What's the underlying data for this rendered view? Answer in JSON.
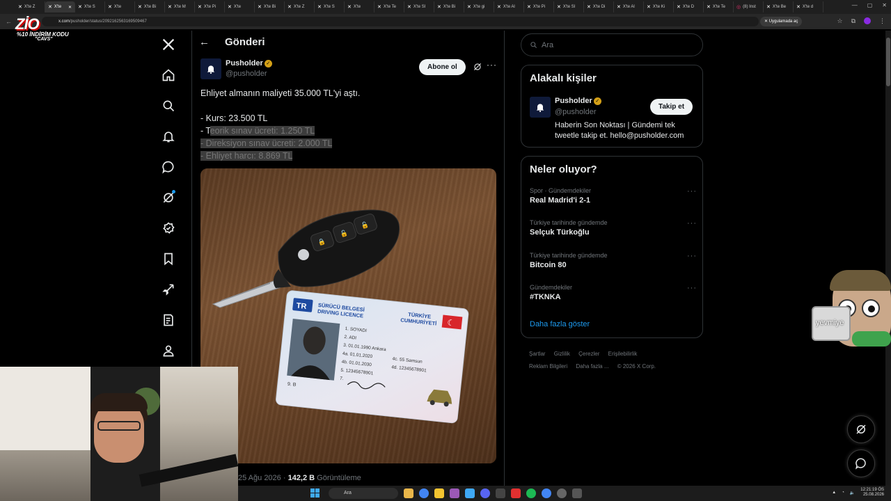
{
  "browser": {
    "tabs": [
      {
        "label": "X'te Z"
      },
      {
        "label": "X'te"
      },
      {
        "label": "X'te S"
      },
      {
        "label": "X'te"
      },
      {
        "label": "X'te Bi"
      },
      {
        "label": "X'te M"
      },
      {
        "label": "X'te Pi"
      },
      {
        "label": "X'te"
      },
      {
        "label": "X'te Bi"
      },
      {
        "label": "X'te Z"
      },
      {
        "label": "X'te S"
      },
      {
        "label": "X'te"
      },
      {
        "label": "X'te Te"
      },
      {
        "label": "X'te Sl"
      },
      {
        "label": "X'te Bi"
      },
      {
        "label": "X'te gi"
      },
      {
        "label": "X'te Al"
      },
      {
        "label": "X'te Pi"
      },
      {
        "label": "X'te Sl"
      },
      {
        "label": "X'te Di"
      },
      {
        "label": "X'te Al"
      },
      {
        "label": "X'te Ki"
      },
      {
        "label": "X'te D"
      },
      {
        "label": "X'te Te"
      },
      {
        "label": "(8) Inst"
      },
      {
        "label": "X'te Be"
      },
      {
        "label": "X'te d"
      }
    ],
    "url_domain": "x.com",
    "url_path": "/pusholder/status/2092162563169509467",
    "open_app_label": "Uygulamada aç"
  },
  "stream_overlay": {
    "logo_text": "ZİO",
    "promo_line1": "%10 İNDİRİM KODU",
    "promo_line2": "\"CAVS\""
  },
  "nav": {
    "items": [
      {
        "name": "x-logo-icon"
      },
      {
        "name": "home-icon"
      },
      {
        "name": "explore-icon"
      },
      {
        "name": "notifications-icon"
      },
      {
        "name": "messages-icon"
      },
      {
        "name": "grok-icon"
      },
      {
        "name": "communities-icon"
      },
      {
        "name": "bookmarks-icon"
      },
      {
        "name": "jobs-icon"
      },
      {
        "name": "lists-icon"
      },
      {
        "name": "profile-icon"
      }
    ]
  },
  "header": {
    "title": "Gönderi"
  },
  "post": {
    "author_name": "Pusholder",
    "author_handle": "@pusholder",
    "subscribe_label": "Abone ol",
    "text_line1": "Ehliyet almanın maliyeti 35.000 TL'yi aştı.",
    "text_line2": "- Kurs: 23.500 TL",
    "text_line3_plain": "- T",
    "text_line3_selected": "eorik sınav ücreti: 1.250 TL",
    "text_line4": "- Direksiyon sınav ücreti: 2.000 TL",
    "text_line5": "- Ehliyet harcı: 8.869 TL",
    "date": "25 Ağu 2026",
    "views_count": "142,2 B",
    "views_label": "Görüntüleme"
  },
  "license_card": {
    "country_code": "TR",
    "title1": "SÜRÜCÜ BELGESİ",
    "title2": "DRIVING LICENCE",
    "issuer1": "TÜRKİYE",
    "issuer2": "CUMHURİYETİ",
    "field1": "1.  SOYADI",
    "field2": "2.  ADI",
    "field3": "3.  01.01.1990   Ankara",
    "field4a": "4a. 01.01.2020",
    "field4c": "4c. 55 Samsun",
    "field4b": "4b. 01.01.2030",
    "field4d": "4d. 12345678901",
    "field5": "5.  12345678901",
    "field7": "7.",
    "field9": "9.  B"
  },
  "sidebar": {
    "search_placeholder": "Ara",
    "related_title": "Alakalı kişiler",
    "related_name": "Pusholder",
    "related_handle": "@pusholder",
    "follow_label": "Takip et",
    "related_bio": "Haberin Son Noktası | Gündemi tek tweetle takip et. hello@pusholder.com",
    "trends_title": "Neler oluyor?",
    "trends": [
      {
        "category": "Spor · Gündemdekiler",
        "name": "Real Madrid'i 2-1"
      },
      {
        "category": "Türkiye tarihinde gündemde",
        "name": "Selçuk Türkoğlu"
      },
      {
        "category": "Türkiye tarihinde gündemde",
        "name": "Bitcoin 80"
      },
      {
        "category": "Gündemdekiler",
        "name": "#TKNKA"
      }
    ],
    "show_more": "Daha fazla göster",
    "footer_links": [
      "Şartlar",
      "Gizlilik",
      "Çerezler",
      "Erişilebilirlik",
      "Reklam Bilgileri",
      "Daha fazla ...",
      "© 2026 X Corp."
    ]
  },
  "sticker": {
    "label": "yevmiye"
  },
  "taskbar": {
    "search_label": "Ara",
    "time": "12:21:19 ÖS",
    "date": "25.08.2026"
  },
  "colors": {
    "accent": "#1d9bf0",
    "verified_gold": "#d4a017",
    "background": "#000000",
    "border": "#2f3336"
  }
}
